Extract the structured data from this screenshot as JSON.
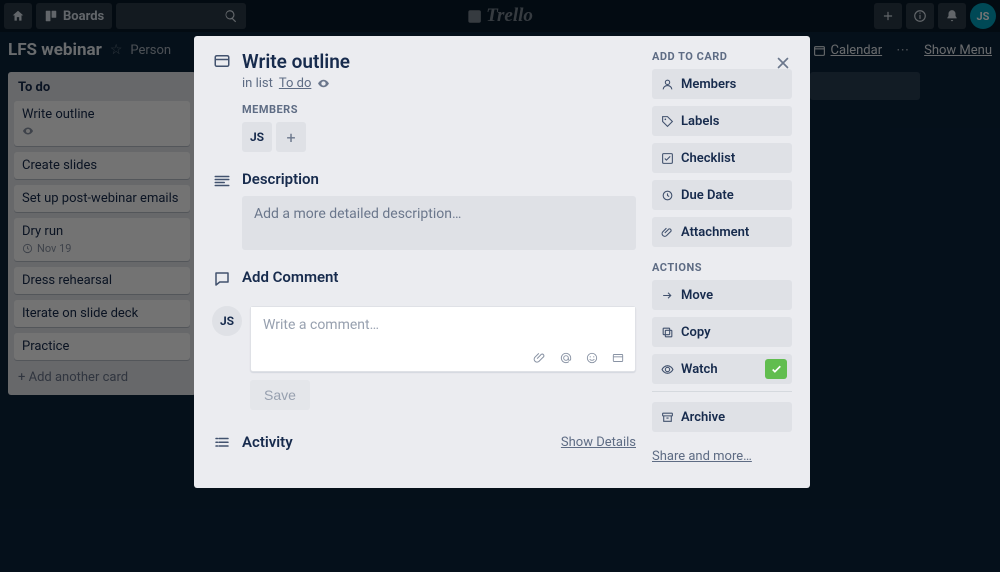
{
  "header": {
    "boards_label": "Boards",
    "brand": "Trello",
    "user_initials": "JS"
  },
  "board_bar": {
    "name": "LFS webinar",
    "team": "Person",
    "calendar": "Calendar",
    "show_menu": "Show Menu"
  },
  "list": {
    "title": "To do",
    "add_label": "+  Add another card",
    "cards": [
      {
        "title": "Write outline",
        "watch": true
      },
      {
        "title": "Create slides"
      },
      {
        "title": "Set up post-webinar emails"
      },
      {
        "title": "Dry run",
        "date": "Nov 19"
      },
      {
        "title": "Dress rehearsal"
      },
      {
        "title": "Iterate on slide deck"
      },
      {
        "title": "Practice"
      }
    ]
  },
  "modal": {
    "title": "Write outline",
    "in_list_prefix": "in list",
    "in_list_name": "To do",
    "members_label": "MEMBERS",
    "member_initials": "JS",
    "description_label": "Description",
    "description_placeholder": "Add a more detailed description…",
    "add_comment_label": "Add Comment",
    "comment_placeholder": "Write a comment…",
    "save_label": "Save",
    "activity_label": "Activity",
    "show_details": "Show Details",
    "commenter_initials": "JS"
  },
  "sidebar": {
    "add_to_card": "ADD TO CARD",
    "members": "Members",
    "labels": "Labels",
    "checklist": "Checklist",
    "due_date": "Due Date",
    "attachment": "Attachment",
    "actions": "ACTIONS",
    "move": "Move",
    "copy": "Copy",
    "watch": "Watch",
    "archive": "Archive",
    "share": "Share and more…"
  }
}
